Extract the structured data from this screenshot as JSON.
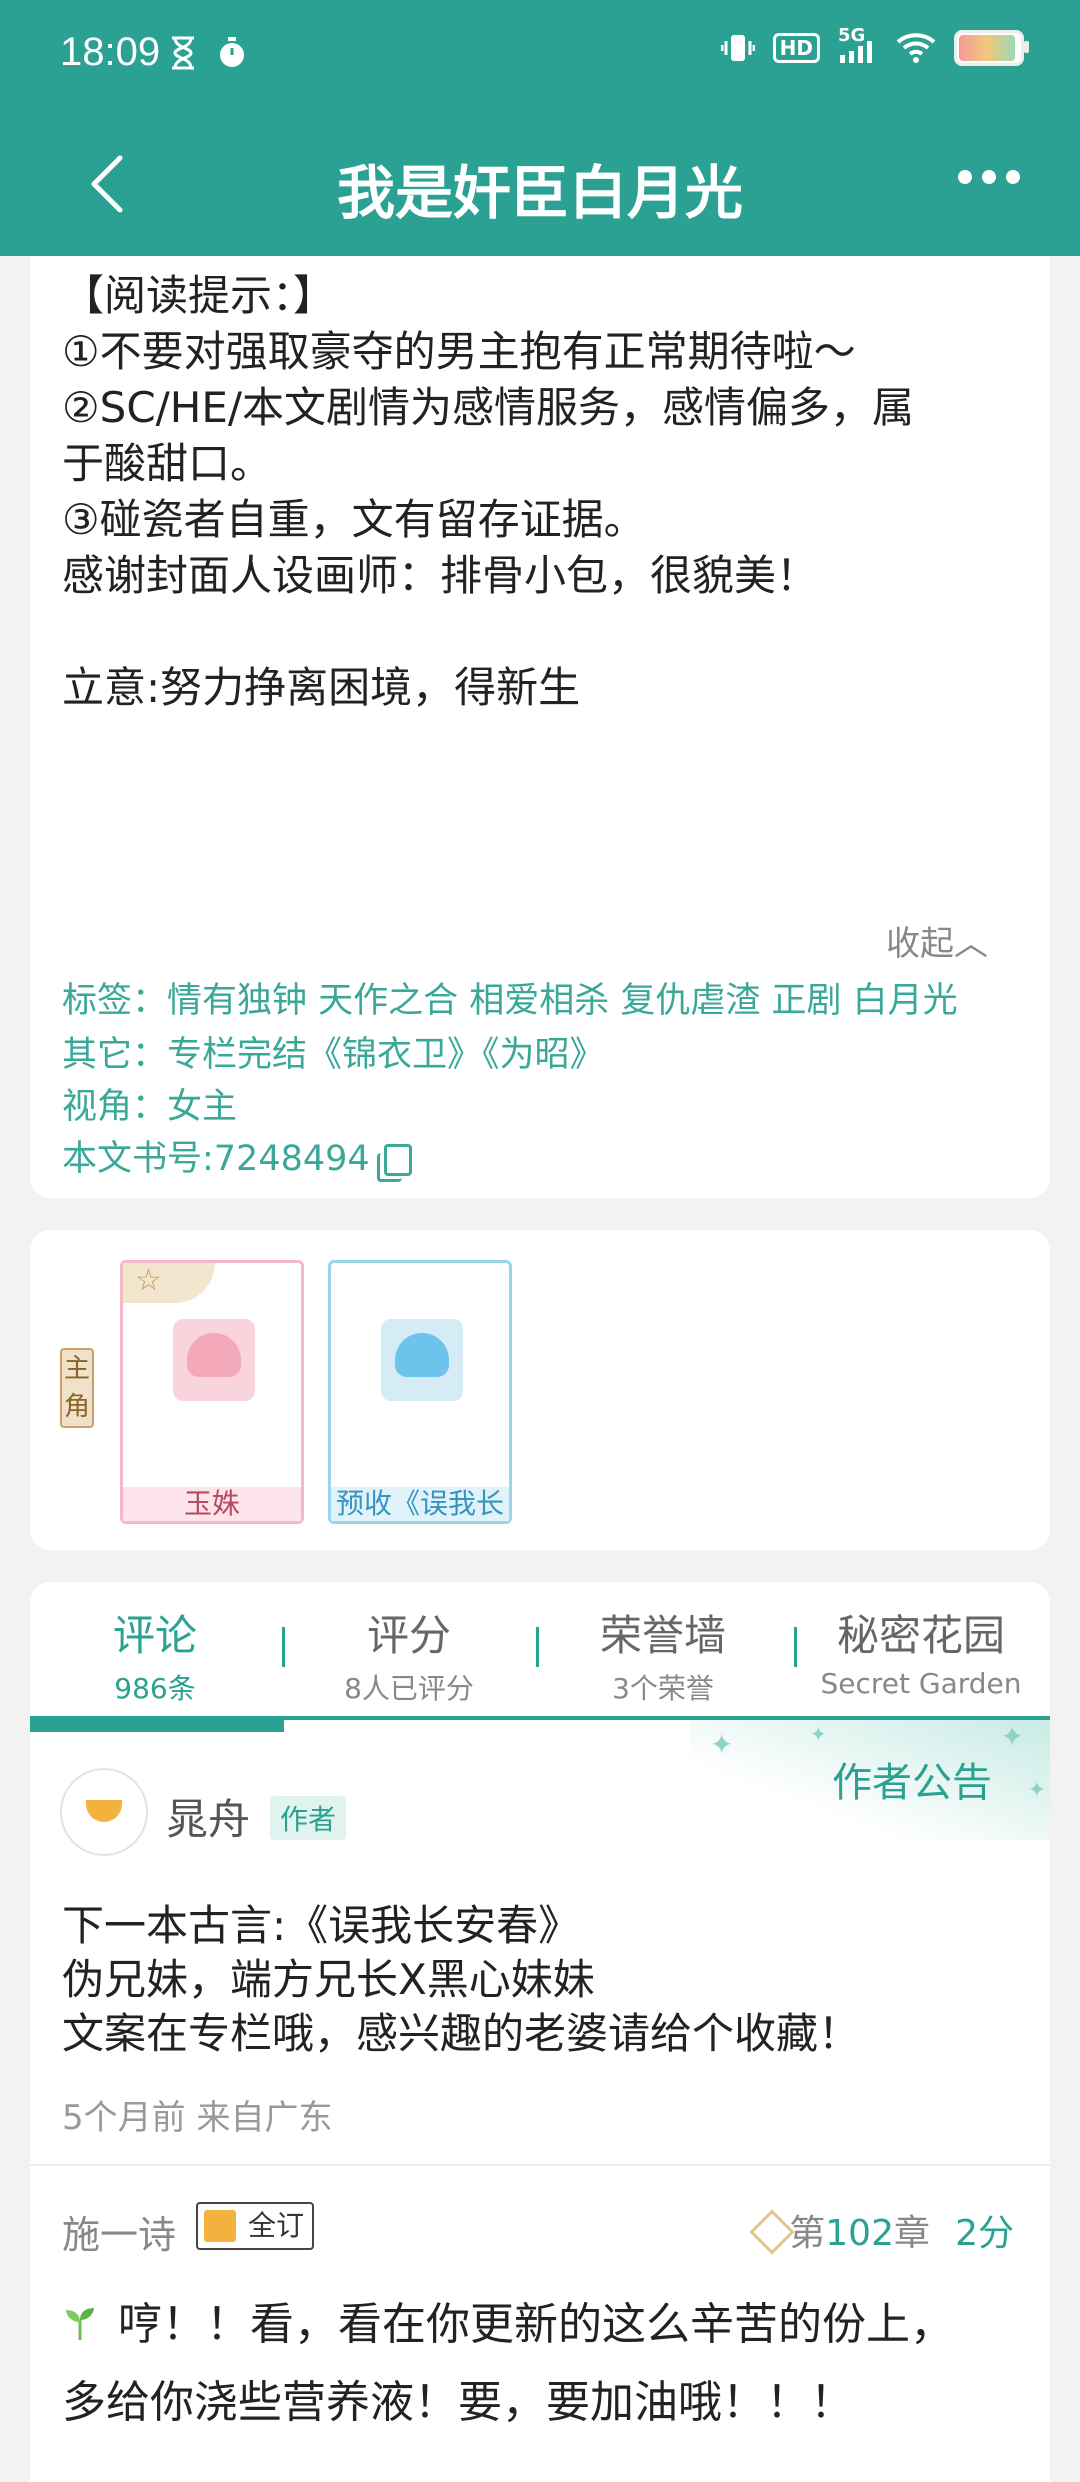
{
  "status_bar": {
    "time": "18:09",
    "icons": [
      "hourglass-icon",
      "timer-icon",
      "vibrate-icon",
      "hd-icon",
      "signal-5g-icon",
      "wifi-icon",
      "battery-icon"
    ],
    "hd": "HD",
    "network": "5G"
  },
  "app_bar": {
    "title": "我是奸臣白月光"
  },
  "intro": {
    "lines": [
      "【阅读提示：】",
      "①不要对强取豪夺的男主抱有正常期待啦～",
      "②SC/HE/本文剧情为感情服务，感情偏多，属",
      "于酸甜口。",
      "③碰瓷者自重，文有留存证据。",
      "感谢封面人设画师：排骨小包，很貌美！",
      "立意:努力挣离困境，得新生"
    ],
    "collapse": "收起︿",
    "tags": "标签：情有独钟 天作之合 相爱相杀 复仇虐渣 正剧 白月光",
    "other": "其它：专栏完结《锦衣卫》《为昭》",
    "view": "视角：女主",
    "book_id": "本文书号:7248494"
  },
  "roles": {
    "tag": "主角",
    "cards": [
      {
        "name": "玉姝"
      },
      {
        "name": "预收《误我长"
      }
    ]
  },
  "tabs": [
    {
      "title": "评论",
      "sub": "986条"
    },
    {
      "title": "评分",
      "sub": "8人已评分"
    },
    {
      "title": "荣誉墙",
      "sub": "3个荣誉"
    },
    {
      "title": "秘密花园",
      "sub": "Secret Garden"
    }
  ],
  "notice": {
    "banner": "作者公告",
    "author": "晁舟",
    "author_badge": "作者",
    "lines": [
      "下一本古言:《误我长安春》",
      "伪兄妹，端方兄长X黑心妹妹",
      "文案在专栏哦，感兴趣的老婆请给个收藏！"
    ],
    "time": "5个月前 来自广东"
  },
  "comment": {
    "user": "施一诗",
    "badge": "全订",
    "chapter_prefix": "第",
    "chapter_num": "102",
    "chapter_suffix": "章",
    "score": "2分",
    "text1": "哼！！看，看在你更新的这么辛苦的份上，",
    "text2": "多给你浇些营养液！要，要加油哦！！！"
  },
  "colors": {
    "primary": "#2aa193",
    "tag_text": "#3aa898"
  }
}
